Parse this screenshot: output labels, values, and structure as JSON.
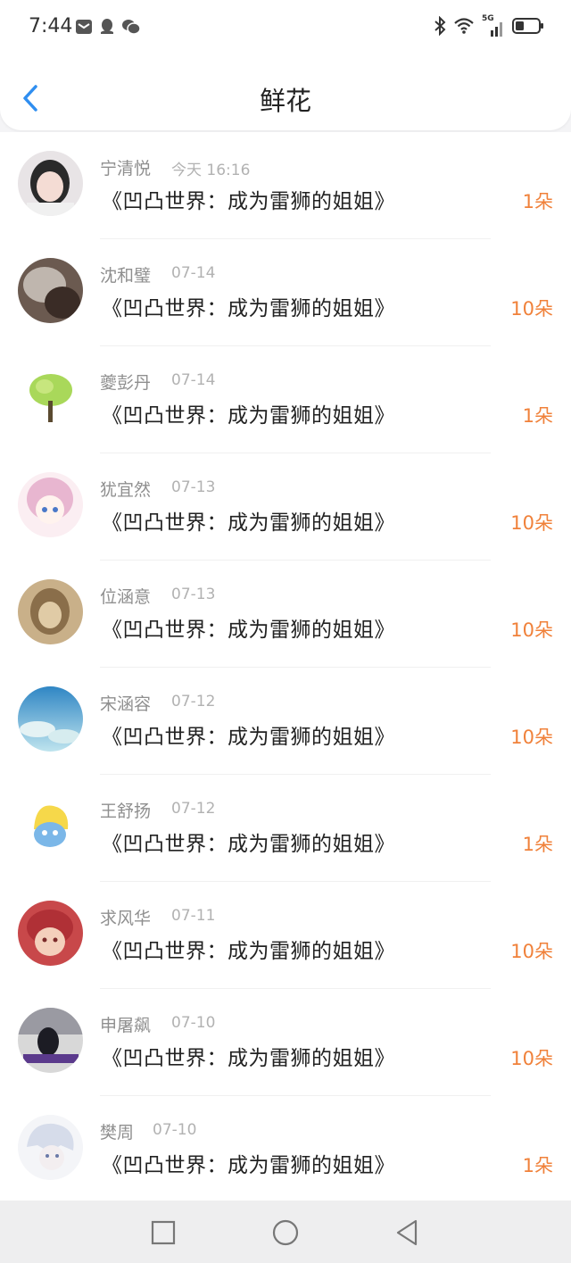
{
  "status": {
    "time": "7:44",
    "notif_icons": [
      "mail-icon",
      "qq-icon",
      "wechat-icon"
    ],
    "right_icons": [
      "bluetooth-icon",
      "wifi-icon",
      "5g-signal-icon",
      "battery-icon"
    ],
    "network": "5G"
  },
  "header": {
    "title": "鲜花",
    "back_icon": "back-chevron-icon"
  },
  "colors": {
    "accent": "#2f8ef0",
    "count": "#f0813a"
  },
  "items": [
    {
      "name": "宁清悦",
      "date": "今天 16:16",
      "book": "《凹凸世界：成为雷狮的姐姐》",
      "count": "1朵"
    },
    {
      "name": "沈和璧",
      "date": "07-14",
      "book": "《凹凸世界：成为雷狮的姐姐》",
      "count": "10朵"
    },
    {
      "name": "夔彭丹",
      "date": "07-14",
      "book": "《凹凸世界：成为雷狮的姐姐》",
      "count": "1朵"
    },
    {
      "name": "犹宜然",
      "date": "07-13",
      "book": "《凹凸世界：成为雷狮的姐姐》",
      "count": "10朵"
    },
    {
      "name": "位涵意",
      "date": "07-13",
      "book": "《凹凸世界：成为雷狮的姐姐》",
      "count": "10朵"
    },
    {
      "name": "宋涵容",
      "date": "07-12",
      "book": "《凹凸世界：成为雷狮的姐姐》",
      "count": "10朵"
    },
    {
      "name": "王舒扬",
      "date": "07-12",
      "book": "《凹凸世界：成为雷狮的姐姐》",
      "count": "1朵"
    },
    {
      "name": "求风华",
      "date": "07-11",
      "book": "《凹凸世界：成为雷狮的姐姐》",
      "count": "10朵"
    },
    {
      "name": "申屠飙",
      "date": "07-10",
      "book": "《凹凸世界：成为雷狮的姐姐》",
      "count": "10朵"
    },
    {
      "name": "樊周",
      "date": "07-10",
      "book": "《凹凸世界：成为雷狮的姐姐》",
      "count": "1朵"
    }
  ],
  "nav_bar": {
    "icons": [
      "recent-apps-icon",
      "home-icon",
      "back-icon"
    ]
  }
}
